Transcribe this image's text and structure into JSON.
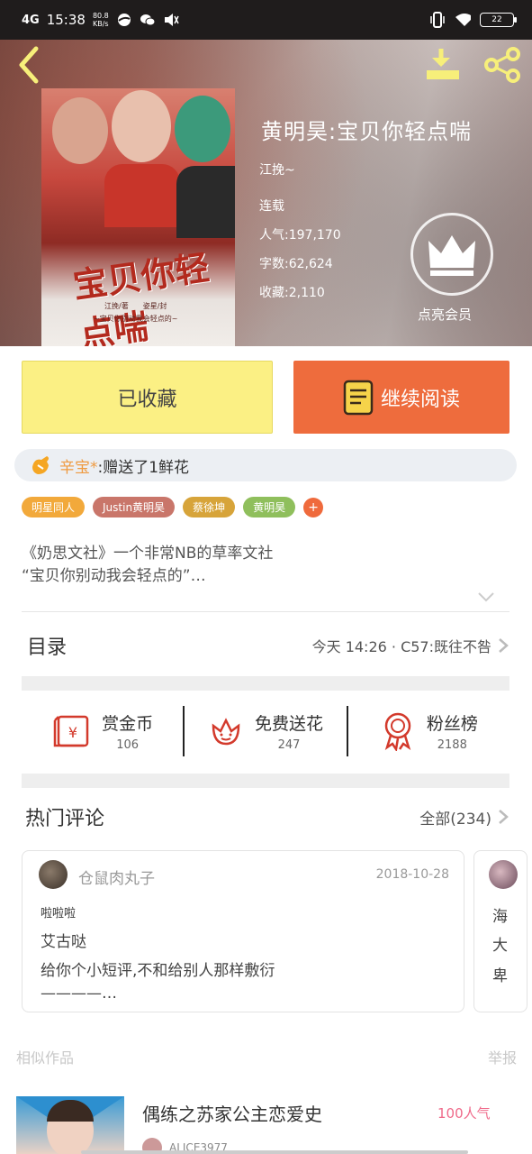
{
  "status_bar": {
    "network": "4G",
    "time": "15:38",
    "speed_value": "80.8",
    "speed_unit": "KB/s",
    "battery": "22"
  },
  "book": {
    "title": "黄明昊:宝贝你轻点喘",
    "author": "江挽~",
    "status": "连载",
    "popularity": "人气:197,170",
    "word_count": "字数:62,624",
    "favorites": "收藏:2,110",
    "vip_label": "点亮会员",
    "cover_title": "宝贝你轻点喘",
    "cover_credits": "江挽/著　　姿星/封",
    "cover_tagline": "~宝贝你别动我会轻点的~"
  },
  "actions": {
    "collected_label": "已收藏",
    "continue_label": "继续阅读"
  },
  "gift": {
    "user": "辛宝*",
    "text": ":赠送了1鲜花"
  },
  "tags": [
    {
      "label": "明星同人",
      "color": "#f2a93b"
    },
    {
      "label": "Justin黄明昊",
      "color": "#c9766a"
    },
    {
      "label": "蔡徐坤",
      "color": "#d7a43a"
    },
    {
      "label": "黄明昊",
      "color": "#8fbf5c"
    }
  ],
  "tag_more": "+",
  "synopsis": {
    "line1": "《奶思文社》一个非常NB的草率文社",
    "line2": "“宝贝你别动我会轻点的”…"
  },
  "toc": {
    "label": "目录",
    "latest": "今天 14:26 · C57:既往不咎"
  },
  "stats": {
    "coins_label": "赏金币",
    "coins_value": "106",
    "flowers_label": "免费送花",
    "flowers_value": "247",
    "fans_label": "粉丝榜",
    "fans_value": "2188"
  },
  "comments": {
    "title": "热门评论",
    "all_label": "全部(234)",
    "items": [
      {
        "user": "仓鼠肉丸子",
        "date": "2018-10-28",
        "line1": "啦啦啦",
        "line2": "艾古哒",
        "line3": "给你个小短评,不和给别人那样敷衍",
        "line4": "————…"
      },
      {
        "line1": "海",
        "line2": "大",
        "line3": "卑"
      }
    ]
  },
  "similar": {
    "label": "相似作品",
    "report": "举报"
  },
  "recommend": {
    "title": "偶练之苏家公主恋爱史",
    "popularity": "100人气",
    "author": "ALICE3977"
  },
  "colors": {
    "accent_orange": "#ee6c3d",
    "collected_yellow": "#fbf084",
    "gift_user": "#ef9a3f"
  },
  "icons": [
    "back-icon",
    "download-icon",
    "share-icon",
    "crown-icon",
    "book-icon",
    "hand-icon",
    "chevron-down-icon",
    "chevron-right-icon",
    "red-envelope-icon",
    "flower-icon",
    "medal-icon"
  ]
}
